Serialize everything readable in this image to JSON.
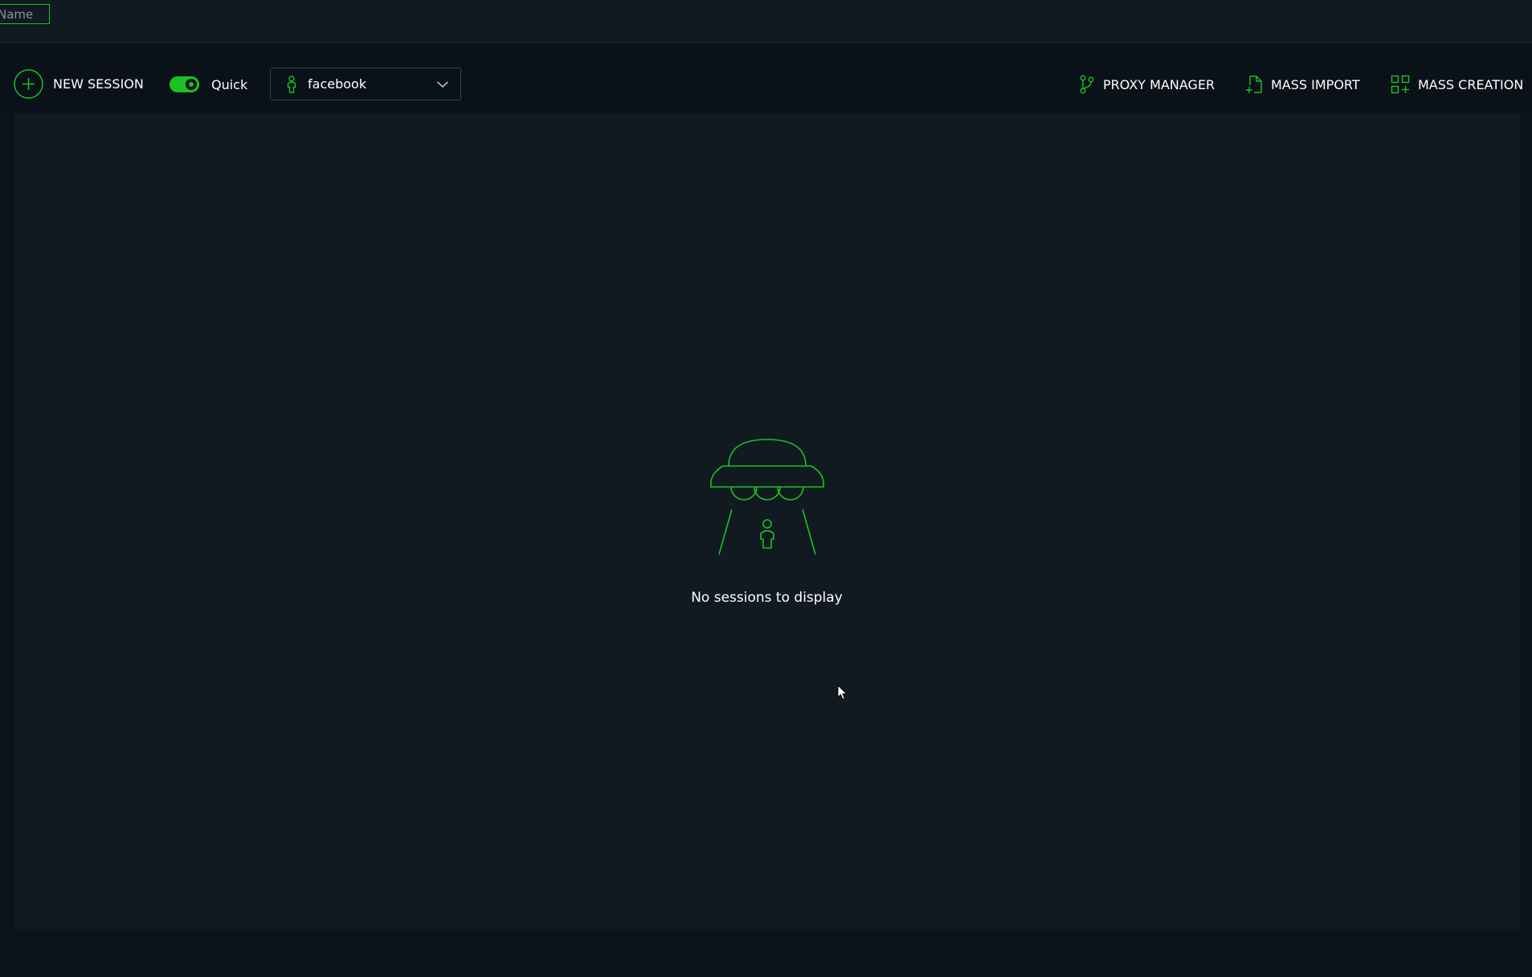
{
  "topbar": {
    "name_placeholder": "Name"
  },
  "toolbar": {
    "new_session_label": "NEW SESSION",
    "quick_toggle": {
      "label": "Quick",
      "on": true
    },
    "profile_select": {
      "value": "facebook"
    },
    "proxy_manager_label": "PROXY MANAGER",
    "mass_import_label": "MASS IMPORT",
    "mass_creation_label": "MASS CREATION"
  },
  "sessions": {
    "empty_message": "No sessions to display",
    "empty_icon": "ufo-abduction-icon"
  },
  "colors": {
    "accent": "#19c323",
    "background": "#0b121a",
    "panel": "#111921",
    "text": "#ffffff"
  }
}
